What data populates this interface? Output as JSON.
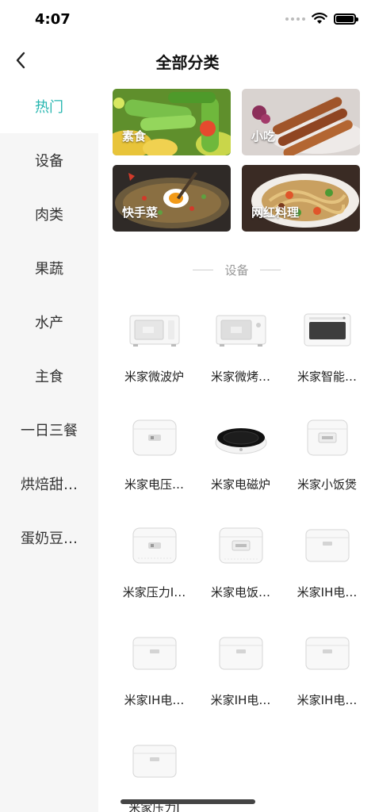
{
  "status_bar": {
    "time": "4:07"
  },
  "nav": {
    "title": "全部分类",
    "back_icon": "chevron-left-icon"
  },
  "colors": {
    "accent": "#27b6b0",
    "sidebar_bg": "#f6f6f6"
  },
  "sidebar": {
    "items": [
      {
        "label": "热门",
        "active": true
      },
      {
        "label": "设备",
        "active": false
      },
      {
        "label": "肉类",
        "active": false
      },
      {
        "label": "果蔬",
        "active": false
      },
      {
        "label": "水产",
        "active": false
      },
      {
        "label": "主食",
        "active": false
      },
      {
        "label": "一日三餐",
        "active": false
      },
      {
        "label": "烘焙甜…",
        "active": false
      },
      {
        "label": "蛋奶豆…",
        "active": false
      }
    ]
  },
  "banners": [
    {
      "label": "素食",
      "image": "vegetables-photo"
    },
    {
      "label": "小吃",
      "image": "skewers-photo"
    },
    {
      "label": "快手菜",
      "image": "fried-rice-photo"
    },
    {
      "label": "网红料理",
      "image": "noodles-photo"
    }
  ],
  "devices_section": {
    "title": "设备",
    "items": [
      {
        "name": "米家微波炉",
        "icon": "microwave-icon"
      },
      {
        "name": "米家微烤…",
        "icon": "microwave-oven-icon"
      },
      {
        "name": "米家智能…",
        "icon": "steam-oven-icon"
      },
      {
        "name": "米家电压…",
        "icon": "pressure-cooker-icon"
      },
      {
        "name": "米家电磁炉",
        "icon": "induction-cooker-icon"
      },
      {
        "name": "米家小饭煲",
        "icon": "small-rice-cooker-icon"
      },
      {
        "name": "米家压力I…",
        "icon": "pressure-rice-cooker-icon"
      },
      {
        "name": "米家电饭…",
        "icon": "rice-cooker-icon"
      },
      {
        "name": "米家IH电…",
        "icon": "ih-rice-cooker-icon"
      },
      {
        "name": "米家IH电…",
        "icon": "ih-rice-cooker-icon"
      },
      {
        "name": "米家IH电…",
        "icon": "ih-rice-cooker-icon"
      },
      {
        "name": "米家IH电…",
        "icon": "ih-rice-cooker-icon"
      },
      {
        "name": "米家压力I",
        "icon": "pressure-rice-cooker-icon"
      }
    ]
  }
}
